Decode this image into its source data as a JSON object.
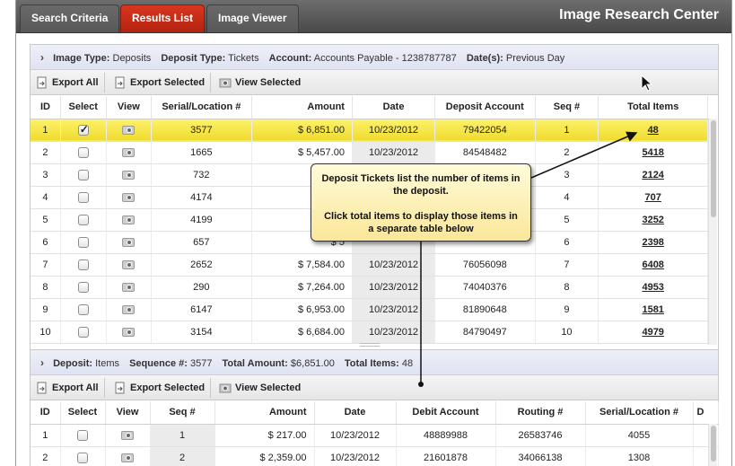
{
  "app": {
    "title": "Image Research Center",
    "tabs": [
      {
        "label": "Search Criteria",
        "active": false
      },
      {
        "label": "Results List",
        "active": true
      },
      {
        "label": "Image Viewer",
        "active": false
      }
    ]
  },
  "criteria": {
    "image_type_label": "Image Type:",
    "image_type": "Deposits",
    "deposit_type_label": "Deposit Type:",
    "deposit_type": "Tickets",
    "account_label": "Account:",
    "account": "Accounts Payable - 1238787787",
    "dates_label": "Date(s):",
    "dates": "Previous Day"
  },
  "toolbar": {
    "export_all": "Export All",
    "export_selected": "Export Selected",
    "view_selected": "View Selected"
  },
  "deposits_table": {
    "columns": [
      "ID",
      "Select",
      "View",
      "Serial/Location #",
      "Amount",
      "Date",
      "Deposit Account",
      "Seq #",
      "Total Items"
    ],
    "rows": [
      {
        "id": "1",
        "selected": true,
        "serial": "3577",
        "amount": "$ 6,851.00",
        "date": "10/23/2012",
        "account": "79422054",
        "seq": "1",
        "total": "48"
      },
      {
        "id": "2",
        "selected": false,
        "serial": "1665",
        "amount": "$ 5,457.00",
        "date": "10/23/2012",
        "account": "84548482",
        "seq": "2",
        "total": "5418"
      },
      {
        "id": "3",
        "selected": false,
        "serial": "732",
        "amount": "$ 5",
        "date": "",
        "account": "",
        "seq": "3",
        "total": "2124"
      },
      {
        "id": "4",
        "selected": false,
        "serial": "4174",
        "amount": "$ 5",
        "date": "",
        "account": "",
        "seq": "4",
        "total": "707"
      },
      {
        "id": "5",
        "selected": false,
        "serial": "4199",
        "amount": "$ 5",
        "date": "",
        "account": "",
        "seq": "5",
        "total": "3252"
      },
      {
        "id": "6",
        "selected": false,
        "serial": "657",
        "amount": "$ 5",
        "date": "",
        "account": "",
        "seq": "6",
        "total": "2398"
      },
      {
        "id": "7",
        "selected": false,
        "serial": "2652",
        "amount": "$ 7,584.00",
        "date": "10/23/2012",
        "account": "76056098",
        "seq": "7",
        "total": "6408"
      },
      {
        "id": "8",
        "selected": false,
        "serial": "290",
        "amount": "$ 7,264.00",
        "date": "10/23/2012",
        "account": "74040376",
        "seq": "8",
        "total": "4953"
      },
      {
        "id": "9",
        "selected": false,
        "serial": "6147",
        "amount": "$ 6,953.00",
        "date": "10/23/2012",
        "account": "81890648",
        "seq": "9",
        "total": "1581"
      },
      {
        "id": "10",
        "selected": false,
        "serial": "3154",
        "amount": "$ 6,684.00",
        "date": "10/23/2012",
        "account": "84790497",
        "seq": "10",
        "total": "4979"
      }
    ]
  },
  "deposit_detail": {
    "deposit_label": "Deposit:",
    "deposit": "Items",
    "sequence_label": "Sequence #:",
    "sequence": "3577",
    "total_amount_label": "Total Amount:",
    "total_amount": "$6,851.00",
    "total_items_label": "Total Items:",
    "total_items": "48"
  },
  "items_table": {
    "columns": [
      "ID",
      "Select",
      "View",
      "Seq #",
      "Amount",
      "Date",
      "Debit Account",
      "Routing #",
      "Serial/Location #",
      "D"
    ],
    "rows": [
      {
        "id": "1",
        "seq": "1",
        "amount": "$ 217.00",
        "date": "10/23/2012",
        "debit": "48889988",
        "routing": "26583746",
        "serial": "4055"
      },
      {
        "id": "2",
        "seq": "2",
        "amount": "$ 2,359.00",
        "date": "10/23/2012",
        "debit": "21601878",
        "routing": "34066138",
        "serial": "1308"
      }
    ]
  },
  "callout": {
    "line1": "Deposit Tickets list the number of items in the deposit.",
    "line2": "Click total items to display those items in a separate table below"
  },
  "icons": {
    "export": "document-export-icon",
    "view": "camera-icon",
    "expand": "chevron-right-icon",
    "cursor": "mouse-pointer-icon"
  },
  "colors": {
    "active_tab": "#c82c17",
    "selected_row": "#f6e64a",
    "header_bar": "#4f4f4f"
  }
}
